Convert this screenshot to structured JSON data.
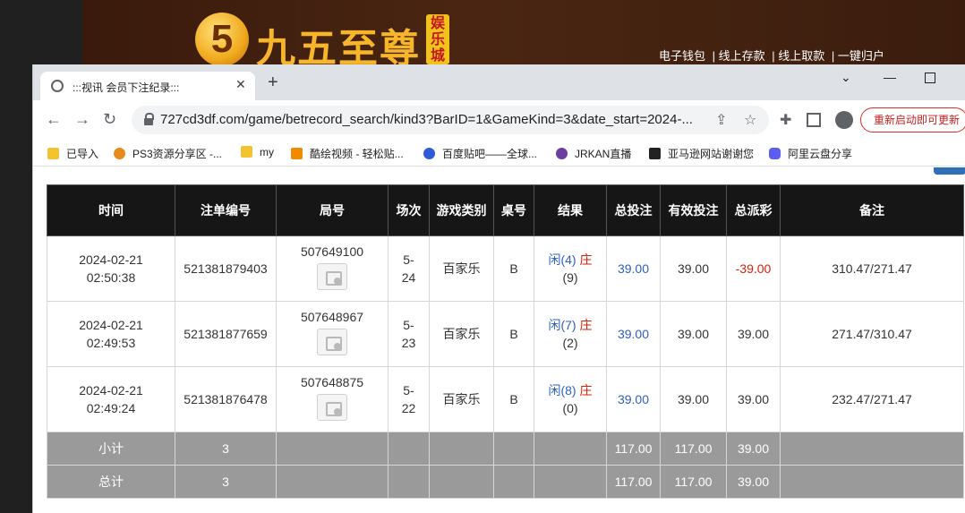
{
  "site": {
    "logo_digit": "5",
    "logo_text": "九五至尊",
    "logo_badge": "娱乐城",
    "nav": [
      "电子钱包",
      "线上存款",
      "线上取款",
      "一键归户"
    ]
  },
  "browser": {
    "tab_title": ":::视讯 会员下注纪录:::",
    "url": "727cd3df.com/game/betrecord_search/kind3?BarID=1&GameKind=3&date_start=2024-...",
    "relaunch_label": "重新启动即可更新",
    "bookmarks": [
      {
        "label": "已导入",
        "icon": "folder-icon",
        "color": "#f4c430"
      },
      {
        "label": "PS3资源分享区 -...",
        "icon": "tiger-icon",
        "color": "#e88a1a"
      },
      {
        "label": "my",
        "icon": "folder-icon",
        "color": "#f4c430"
      },
      {
        "label": "酷绘视频 - 轻松贴...",
        "icon": "k-logo-icon",
        "color": "#f08a00"
      },
      {
        "label": "百度贴吧——全球...",
        "icon": "paw-icon",
        "color": "#2e5bd8"
      },
      {
        "label": "JRKAN直播",
        "icon": "jrkan-icon",
        "color": "#6a3fa0"
      },
      {
        "label": "亚马逊网站谢谢您",
        "icon": "amazon-icon",
        "color": "#222222"
      },
      {
        "label": "阿里云盘分享",
        "icon": "aliyun-icon",
        "color": "#5b5ef0"
      }
    ]
  },
  "table": {
    "headers": [
      "时间",
      "注单编号",
      "局号",
      "场次",
      "游戏类别",
      "桌号",
      "结果",
      "总投注",
      "有效投注",
      "总派彩",
      "备注"
    ],
    "rows": [
      {
        "date": "2024-02-21",
        "time": "02:50:38",
        "bet_no": "521381879403",
        "round": "507649100",
        "shoe": "5-",
        "hand": "24",
        "game": "百家乐",
        "table": "B",
        "player": "闲(4)",
        "banker": "庄",
        "result_extra": "(9)",
        "total_bet": "39.00",
        "valid_bet": "39.00",
        "payout": "-39.00",
        "payout_negative": true,
        "note": "310.47/271.47"
      },
      {
        "date": "2024-02-21",
        "time": "02:49:53",
        "bet_no": "521381877659",
        "round": "507648967",
        "shoe": "5-",
        "hand": "23",
        "game": "百家乐",
        "table": "B",
        "player": "闲(7)",
        "banker": "庄",
        "result_extra": "(2)",
        "total_bet": "39.00",
        "valid_bet": "39.00",
        "payout": "39.00",
        "payout_negative": false,
        "note": "271.47/310.47"
      },
      {
        "date": "2024-02-21",
        "time": "02:49:24",
        "bet_no": "521381876478",
        "round": "507648875",
        "shoe": "5-",
        "hand": "22",
        "game": "百家乐",
        "table": "B",
        "player": "闲(8)",
        "banker": "庄",
        "result_extra": "(0)",
        "total_bet": "39.00",
        "valid_bet": "39.00",
        "payout": "39.00",
        "payout_negative": false,
        "note": "232.47/271.47"
      }
    ],
    "subtotal": {
      "label": "小计",
      "count": "3",
      "total_bet": "117.00",
      "valid_bet": "117.00",
      "payout": "39.00"
    },
    "grand_total": {
      "label": "总计",
      "count": "3",
      "total_bet": "117.00",
      "valid_bet": "117.00",
      "payout": "39.00"
    }
  }
}
